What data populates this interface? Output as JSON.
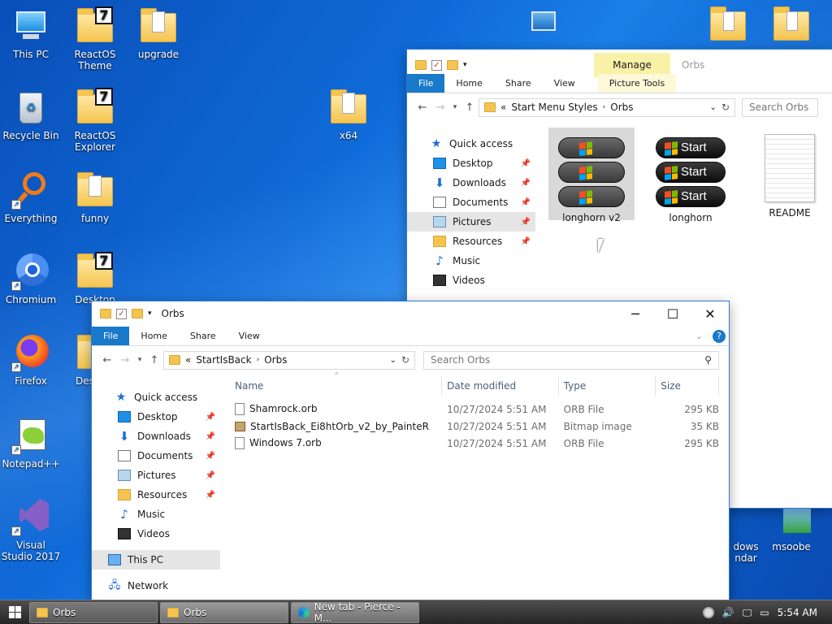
{
  "desktop": {
    "icons": [
      {
        "label": "This PC",
        "icon": "this-pc-icon"
      },
      {
        "label": "ReactOS Theme",
        "icon": "reactos-theme-icon"
      },
      {
        "label": "upgrade",
        "icon": "folder-icon"
      },
      {
        "label": "Recycle Bin",
        "icon": "recycle-bin-icon"
      },
      {
        "label": "ReactOS Explorer",
        "icon": "reactos-explorer-icon"
      },
      {
        "label": "x64",
        "icon": "folder-icon"
      },
      {
        "label": "Everything",
        "icon": "everything-icon"
      },
      {
        "label": "funny",
        "icon": "folder-icon"
      },
      {
        "label": "Chromium",
        "icon": "chromium-icon"
      },
      {
        "label": "Desktop",
        "icon": "desktop-folder-icon"
      },
      {
        "label": "Firefox",
        "icon": "firefox-icon"
      },
      {
        "label": "Des",
        "icon": "folder-icon"
      },
      {
        "label": "Notepad++",
        "icon": "notepadpp-icon"
      },
      {
        "label": "Visual Studio 2017",
        "icon": "visual-studio-icon"
      },
      {
        "label": "dows ndar",
        "icon": "calendar-icon"
      },
      {
        "label": "msoobe",
        "icon": "msoobe-icon"
      }
    ]
  },
  "back_window": {
    "context_tab": "Manage",
    "title": "Orbs",
    "tabs": [
      "File",
      "Home",
      "Share",
      "View",
      "Picture Tools"
    ],
    "path_prefix": "«",
    "path": [
      "Start Menu Styles",
      "Orbs"
    ],
    "search_placeholder": "Search Orbs",
    "nav": [
      {
        "label": "Quick access",
        "icon": "star-icon",
        "pinned": false
      },
      {
        "label": "Desktop",
        "icon": "desktop-icon",
        "pinned": true
      },
      {
        "label": "Downloads",
        "icon": "downloads-icon",
        "pinned": true
      },
      {
        "label": "Documents",
        "icon": "documents-icon",
        "pinned": true
      },
      {
        "label": "Pictures",
        "icon": "pictures-icon",
        "pinned": true
      },
      {
        "label": "Resources",
        "icon": "folder-icon",
        "pinned": true
      },
      {
        "label": "Music",
        "icon": "music-icon",
        "pinned": false
      },
      {
        "label": "Videos",
        "icon": "videos-icon",
        "pinned": false
      }
    ],
    "thumbnails": [
      {
        "label": "longhorn v2",
        "orb_text": ""
      },
      {
        "label": "longhorn",
        "orb_text": "Start"
      },
      {
        "label": "README",
        "orb_text": ""
      }
    ]
  },
  "front_window": {
    "title": "Orbs",
    "tabs": [
      "File",
      "Home",
      "Share",
      "View"
    ],
    "path_prefix": "«",
    "path": [
      "StartIsBack",
      "Orbs"
    ],
    "search_placeholder": "Search Orbs",
    "nav": [
      {
        "label": "Quick access",
        "icon": "star-icon",
        "pinned": false
      },
      {
        "label": "Desktop",
        "icon": "desktop-icon",
        "pinned": true
      },
      {
        "label": "Downloads",
        "icon": "downloads-icon",
        "pinned": true
      },
      {
        "label": "Documents",
        "icon": "documents-icon",
        "pinned": true
      },
      {
        "label": "Pictures",
        "icon": "pictures-icon",
        "pinned": true
      },
      {
        "label": "Resources",
        "icon": "folder-icon",
        "pinned": true
      },
      {
        "label": "Music",
        "icon": "music-icon",
        "pinned": false
      },
      {
        "label": "Videos",
        "icon": "videos-icon",
        "pinned": false
      },
      {
        "label": "This PC",
        "icon": "this-pc-icon",
        "pinned": false
      },
      {
        "label": "Network",
        "icon": "network-icon",
        "pinned": false
      }
    ],
    "columns": [
      "Name",
      "Date modified",
      "Type",
      "Size"
    ],
    "files": [
      {
        "name": "Shamrock.orb",
        "date": "10/27/2024 5:51 AM",
        "type": "ORB File",
        "size": "295 KB",
        "icon": "file-icon"
      },
      {
        "name": "StartIsBack_Ei8htOrb_v2_by_PainteR",
        "date": "10/27/2024 5:51 AM",
        "type": "Bitmap image",
        "size": "35 KB",
        "icon": "bitmap-icon"
      },
      {
        "name": "Windows 7.orb",
        "date": "10/27/2024 5:51 AM",
        "type": "ORB File",
        "size": "295 KB",
        "icon": "file-icon"
      }
    ]
  },
  "taskbar": {
    "buttons": [
      {
        "label": "Orbs",
        "icon": "folder-icon"
      },
      {
        "label": "Orbs",
        "icon": "folder-icon"
      },
      {
        "label": "New tab - Pierce - M...",
        "icon": "edge-icon"
      }
    ],
    "clock": "5:54 AM"
  }
}
